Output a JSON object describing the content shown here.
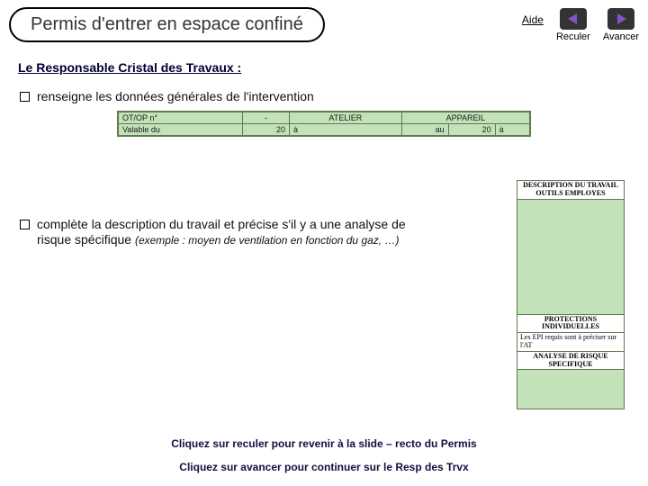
{
  "header": {
    "title": "Permis d'entrer en espace confiné",
    "help": "Aide",
    "back": "Reculer",
    "forward": "Avancer"
  },
  "section_title": "Le Responsable Cristal des Travaux :",
  "bullets": {
    "b1": "renseigne les données générales de l'intervention",
    "b2_main": "complète la description du travail et précise s'il y a une analyse de risque spécifique ",
    "b2_example": "(exemple : moyen de ventilation en fonction du gaz, …)"
  },
  "form": {
    "r1c1": "OT/OP n°",
    "r1c2": "-",
    "r1c3": "ATELIER",
    "r1c4": "APPAREIL",
    "r2c1": "Valable du",
    "r2c2": "20",
    "r2c3": "à",
    "r2c4": "au",
    "r2c5": "20",
    "r2c6": "à"
  },
  "panel": {
    "head1": "DESCRIPTION DU TRAVAIL",
    "head2": "OUTILS EMPLOYES",
    "prot_title": "PROTECTIONS INDIVIDUELLES",
    "prot_text": "Les EPI requis sont à préciser sur l'AT",
    "analysis": "ANALYSE DE RISQUE SPECIFIQUE"
  },
  "footer": {
    "line1": "Cliquez sur reculer pour revenir à la slide – recto du Permis",
    "line2": "Cliquez sur avancer pour continuer sur le Resp des Trvx"
  }
}
